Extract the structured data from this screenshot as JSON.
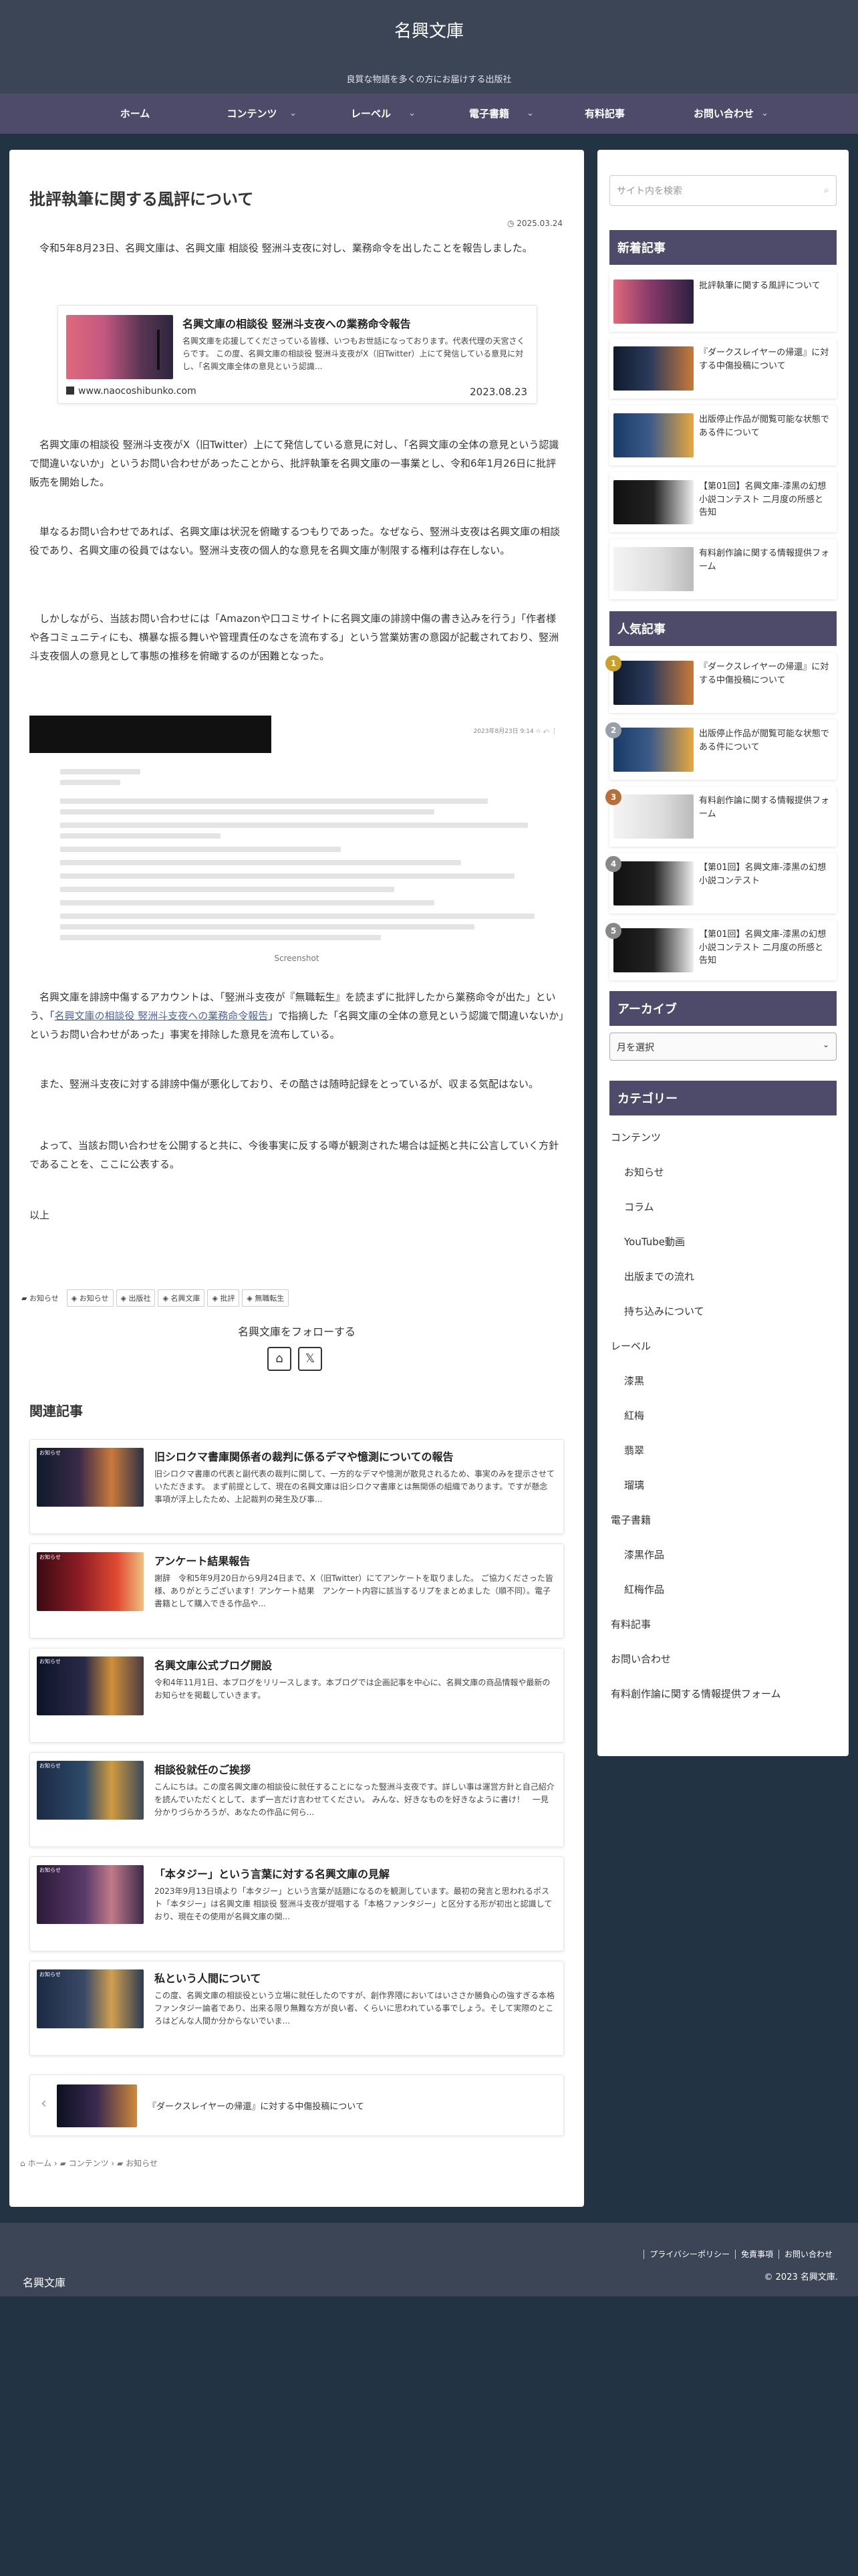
{
  "site": {
    "title": "名興文庫",
    "tagline": "良質な物語を多くの方にお届けする出版社"
  },
  "nav": [
    {
      "label": "ホーム",
      "caret": ""
    },
    {
      "label": "コンテンツ",
      "caret": "⌄"
    },
    {
      "label": "レーベル",
      "caret": "⌄"
    },
    {
      "label": "電子書籍",
      "caret": "⌄"
    },
    {
      "label": "有料記事",
      "caret": ""
    },
    {
      "label": "お問い合わせ",
      "caret": "⌄"
    }
  ],
  "article": {
    "title": "批評執筆に関する風評について",
    "date": "2025.03.24",
    "p1": "令和5年8月23日、名興文庫は、名興文庫 相談役 竪洲斗支夜に対し、業務命令を出したことを報告しました。",
    "blogcard": {
      "title": "名興文庫の相談役 竪洲斗支夜への業務命令報告",
      "desc": "名興文庫を応援してくださっている皆様、いつもお世話になっております。代表代理の天宮さくらです。 この度、名興文庫の相談役 竪洲斗支夜がX（旧Twitter）上にて発信している意見に対し、「名興文庫全体の意見という認識...",
      "site": "www.naocoshibunko.com",
      "date": "2023.08.23"
    },
    "p2": "名興文庫の相談役 竪洲斗支夜がX（旧Twitter）上にて発信している意見に対し、「名興文庫の全体の意見という認識で間違いないか」というお問い合わせがあったことから、批評執筆を名興文庫の一事業とし、令和6年1月26日に批評販売を開始した。",
    "p3": "単なるお問い合わせであれば、名興文庫は状況を俯瞰するつもりであった。なぜなら、竪洲斗支夜は名興文庫の相談役であり、名興文庫の役員ではない。竪洲斗支夜の個人的な意見を名興文庫が制限する権利は存在しない。",
    "p4": "しかしながら、当該お問い合わせには「Amazonや口コミサイトに名興文庫の誹謗中傷の書き込みを行う」「作者様や各コミュニティにも、横暴な振る舞いや管理責任のなさを流布する」という営業妨害の意図が記載されており、竪洲斗支夜個人の意見として事態の推移を俯瞰するのが困難となった。",
    "screenshot": {
      "meta": "2023年8月23日 9:14  ☆  ⤺  ⋮",
      "caption": "Screenshot"
    },
    "p5a": "名興文庫を誹謗中傷するアカウントは、「竪洲斗支夜が『無職転生』を読まずに批評したから業務命令が出た」という、「",
    "p5link": "名興文庫の相談役 竪洲斗支夜への業務命令報告",
    "p5b": "」で指摘した「名興文庫の全体の意見という認識で間違いないか」というお問い合わせがあった」事実を排除した意見を流布している。",
    "p6": "また、竪洲斗支夜に対する誹謗中傷が悪化しており、その酷さは随時記録をとっているが、収まる気配はない。",
    "p7": "よって、当該お問い合わせを公開すると共に、今後事実に反する噂が観測された場合は証拠と共に公言していく方針であることを、ここに公表する。",
    "p8": "以上",
    "category": "お知らせ",
    "tags": [
      "お知らせ",
      "出版社",
      "名興文庫",
      "批評",
      "無職転生"
    ],
    "follow": "名興文庫をフォローする"
  },
  "related": {
    "heading": "関連記事",
    "items": [
      {
        "label": "お知らせ",
        "title": "旧シロクマ書庫関係者の裁判に係るデマや憶測についての報告",
        "desc": "旧シロクマ書庫の代表と副代表の裁判に関して、一方的なデマや憶測が散見されるため、事実のみを提示させていただきます。 まず前提として、現在の名興文庫は旧シロクマ書庫とは無関係の組織であります。ですが懸念事項が浮上したため、上記裁判の発生及び事..."
      },
      {
        "label": "お知らせ",
        "title": "アンケート結果報告",
        "desc": "謝辞　令和5年9月20日から9月24日まで、X（旧Twitter）にてアンケートを取りました。 ご協力くださった皆様、ありがとうございます！アンケート結果　アンケート内容に該当するリプをまとめました（順不同）。電子書籍として購入できる作品や..."
      },
      {
        "label": "お知らせ",
        "title": "名興文庫公式ブログ開設",
        "desc": "令和4年11月1日、本ブログをリリースします。本ブログでは企画記事を中心に、名興文庫の商品情報や最新のお知らせを掲載していきます。"
      },
      {
        "label": "お知らせ",
        "title": "相談役就任のご挨拶",
        "desc": "こんにちは。この度名興文庫の相談役に就任することになった竪洲斗支夜です。詳しい事は運営方針と自己紹介を読んでいただくとして、まず一言だけ言わせてください。 みんな、好きなものを好きなように書け！　一見分かりづらかろうが、あなたの作品に何ら..."
      },
      {
        "label": "お知らせ",
        "title": "「本タジー」という言葉に対する名興文庫の見解",
        "desc": "2023年9月13日頃より「本タジー」という言葉が話題になるのを観測しています。最初の発言と思われるポスト「本タジー」は名興文庫 相談役 竪洲斗支夜が提唱する「本格ファンタジー」と区分する形が初出と認識しており、現在その使用が名興文庫の関..."
      },
      {
        "label": "お知らせ",
        "title": "私という人間について",
        "desc": "この度、名興文庫の相談役という立場に就任したのですが、創作界隈においてはいささか勝負心の強すぎる本格ファンタジー論者であり、出来る限り無難な方が良い者、くらいに思われている事でしょう。そして実際のところはどんな人間か分からないでいま..."
      }
    ]
  },
  "prev_post": {
    "title": "『ダークスレイヤーの帰還』に対する中傷投稿について"
  },
  "breadcrumb": {
    "home": "ホーム",
    "content": "コンテンツ",
    "news": "お知らせ"
  },
  "sidebar": {
    "search_placeholder": "サイト内を検索",
    "recent_heading": "新着記事",
    "recent": [
      "批評執筆に関する風評について",
      "『ダークスレイヤーの帰還』に対する中傷投稿について",
      "出版停止作品が閲覧可能な状態である件について",
      "【第01回】名興文庫-漆黒の幻想小説コンテスト 二月度の所感と告知",
      "有料創作論に関する情報提供フォーム"
    ],
    "popular_heading": "人気記事",
    "popular": [
      {
        "rank": "1",
        "title": "『ダークスレイヤーの帰還』に対する中傷投稿について"
      },
      {
        "rank": "2",
        "title": "出版停止作品が閲覧可能な状態である件について"
      },
      {
        "rank": "3",
        "title": "有料創作論に関する情報提供フォーム"
      },
      {
        "rank": "4",
        "title": "【第01回】名興文庫-漆黒の幻想小説コンテスト"
      },
      {
        "rank": "5",
        "title": "【第01回】名興文庫-漆黒の幻想小説コンテスト 二月度の所感と告知"
      }
    ],
    "archive_heading": "アーカイブ",
    "archive_select": "月を選択",
    "category_heading": "カテゴリー",
    "categories": [
      {
        "label": "コンテンツ",
        "level": 0
      },
      {
        "label": "お知らせ",
        "level": 1
      },
      {
        "label": "コラム",
        "level": 1
      },
      {
        "label": "YouTube動画",
        "level": 1
      },
      {
        "label": "出版までの流れ",
        "level": 1
      },
      {
        "label": "持ち込みについて",
        "level": 1
      },
      {
        "label": "レーベル",
        "level": 0
      },
      {
        "label": "漆黒",
        "level": 1
      },
      {
        "label": "紅梅",
        "level": 1
      },
      {
        "label": "翡翠",
        "level": 1
      },
      {
        "label": "瑠璃",
        "level": 1
      },
      {
        "label": "電子書籍",
        "level": 0
      },
      {
        "label": "漆黒作品",
        "level": 1
      },
      {
        "label": "紅梅作品",
        "level": 1
      },
      {
        "label": "有料記事",
        "level": 0
      },
      {
        "label": "お問い合わせ",
        "level": 0
      },
      {
        "label": "有料創作論に関する情報提供フォーム",
        "level": 0
      }
    ]
  },
  "footer": {
    "title": "名興文庫",
    "links": [
      "プライバシーポリシー",
      "免責事項",
      "お問い合わせ"
    ],
    "copyright": "© 2023 名興文庫."
  },
  "colors": {
    "header": "#3b4555",
    "nav": "#4e4b6a",
    "body_bg": "#223444",
    "link": "#4a5fa6"
  },
  "icons": [
    "clock-icon",
    "folder-icon",
    "tag-icon",
    "home-icon",
    "x-logo-icon",
    "search-icon",
    "chevron-left-icon",
    "chevron-down-icon"
  ]
}
